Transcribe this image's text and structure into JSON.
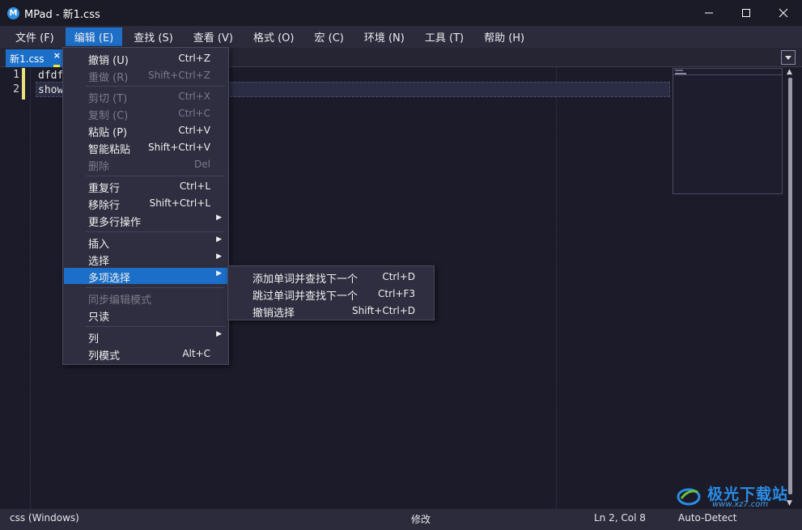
{
  "window": {
    "app_icon_letter": "M",
    "title": "MPad - 新1.css"
  },
  "menubar": [
    {
      "label": "文件 (F)"
    },
    {
      "label": "编辑 (E)"
    },
    {
      "label": "查找 (S)"
    },
    {
      "label": "查看 (V)"
    },
    {
      "label": "格式 (O)"
    },
    {
      "label": "宏 (C)"
    },
    {
      "label": "环境 (N)"
    },
    {
      "label": "工具 (T)"
    },
    {
      "label": "帮助 (H)"
    }
  ],
  "tabs": [
    {
      "label": "新1.css",
      "close": "×"
    }
  ],
  "editor": {
    "line_numbers": [
      "1",
      "2"
    ],
    "lines": [
      "dfdf",
      "show"
    ]
  },
  "edit_menu": [
    {
      "label": "撤销 (U)",
      "shortcut": "Ctrl+Z",
      "enabled": true
    },
    {
      "label": "重做 (R)",
      "shortcut": "Shift+Ctrl+Z",
      "enabled": false
    },
    {
      "label": "剪切 (T)",
      "shortcut": "Ctrl+X",
      "enabled": false
    },
    {
      "label": "复制 (C)",
      "shortcut": "Ctrl+C",
      "enabled": false
    },
    {
      "label": "粘贴 (P)",
      "shortcut": "Ctrl+V",
      "enabled": true
    },
    {
      "label": "智能粘贴",
      "shortcut": "Shift+Ctrl+V",
      "enabled": true
    },
    {
      "label": "删除",
      "shortcut": "Del",
      "enabled": false
    },
    {
      "label": "重复行",
      "shortcut": "Ctrl+L",
      "enabled": true
    },
    {
      "label": "移除行",
      "shortcut": "Shift+Ctrl+L",
      "enabled": true
    },
    {
      "label": "更多行操作",
      "shortcut": "",
      "enabled": true
    },
    {
      "label": "插入",
      "shortcut": "",
      "enabled": true
    },
    {
      "label": "选择",
      "shortcut": "",
      "enabled": true
    },
    {
      "label": "多项选择",
      "shortcut": "",
      "enabled": true
    },
    {
      "label": "同步编辑模式",
      "shortcut": "",
      "enabled": false
    },
    {
      "label": "只读",
      "shortcut": "",
      "enabled": true
    },
    {
      "label": "列",
      "shortcut": "",
      "enabled": true
    },
    {
      "label": "列模式",
      "shortcut": "Alt+C",
      "enabled": true
    }
  ],
  "multi_select_submenu": [
    {
      "label": "添加单词并查找下一个",
      "shortcut": "Ctrl+D"
    },
    {
      "label": "跳过单词并查找下一个",
      "shortcut": "Ctrl+F3"
    },
    {
      "label": "撤销选择",
      "shortcut": "Shift+Ctrl+D"
    }
  ],
  "statusbar": {
    "language": "css (Windows)",
    "state": "修改",
    "position": "Ln 2, Col 8",
    "encoding": "Auto-Detect"
  },
  "watermark": {
    "title": "极光下载站",
    "url": "www.xz7.com"
  },
  "colors": {
    "accent": "#1b6fc8",
    "editor_bg": "#1b1b2a",
    "menu_bg": "#2e2e40",
    "modified_marker": "#f2e23c"
  }
}
